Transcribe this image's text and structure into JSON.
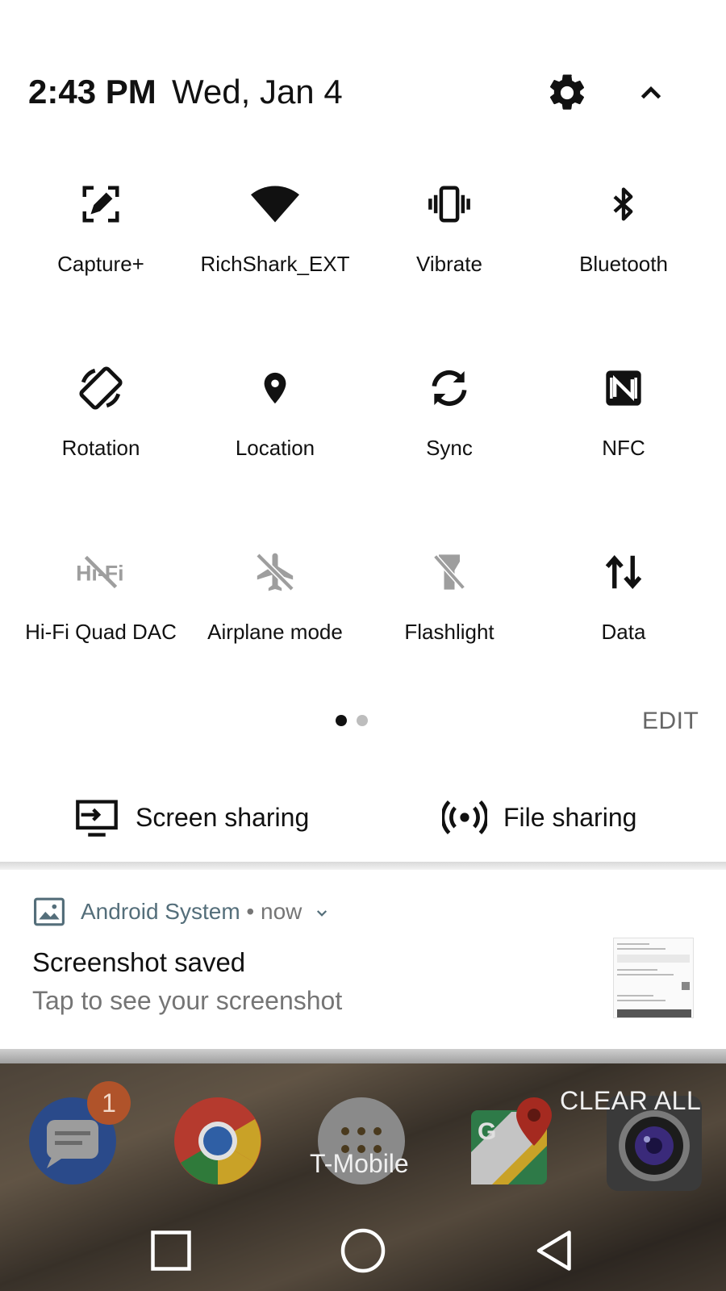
{
  "header": {
    "time": "2:43 PM",
    "date": "Wed, Jan 4",
    "settings_icon": "gear-icon",
    "collapse_icon": "chevron-up-icon"
  },
  "tiles": [
    {
      "label": "Capture+",
      "icon": "capture-plus-icon",
      "active": true
    },
    {
      "label": "RichShark_EXT",
      "icon": "wifi-icon",
      "active": true
    },
    {
      "label": "Vibrate",
      "icon": "vibrate-icon",
      "active": true
    },
    {
      "label": "Bluetooth",
      "icon": "bluetooth-icon",
      "active": true
    },
    {
      "label": "Rotation",
      "icon": "rotation-icon",
      "active": true
    },
    {
      "label": "Location",
      "icon": "location-icon",
      "active": true
    },
    {
      "label": "Sync",
      "icon": "sync-icon",
      "active": true
    },
    {
      "label": "NFC",
      "icon": "nfc-icon",
      "active": true
    },
    {
      "label": "Hi-Fi Quad DAC",
      "icon": "hifi-off-icon",
      "active": false
    },
    {
      "label": "Airplane mode",
      "icon": "airplane-off-icon",
      "active": false
    },
    {
      "label": "Flashlight",
      "icon": "flashlight-off-icon",
      "active": false
    },
    {
      "label": "Data",
      "icon": "data-transfer-icon",
      "active": true
    }
  ],
  "pager": {
    "pages": 2,
    "current": 1
  },
  "edit_label": "EDIT",
  "share": {
    "screen_sharing": "Screen sharing",
    "file_sharing": "File sharing"
  },
  "notification": {
    "app_name": "Android System",
    "separator": " • ",
    "time": "now",
    "title": "Screenshot saved",
    "body": "Tap to see your screenshot"
  },
  "home": {
    "badge_count": "1",
    "clear_all": "CLEAR ALL",
    "carrier": "T-Mobile",
    "apps": [
      "messages-icon",
      "chrome-icon",
      "app-drawer-icon",
      "maps-icon",
      "camera-icon"
    ]
  },
  "colors": {
    "panel_bg": "#ffffff",
    "text_primary": "#111111",
    "text_secondary": "#757575",
    "app_name": "#546e7a",
    "inactive_icon": "#9e9e9e",
    "badge": "#b0532a"
  }
}
